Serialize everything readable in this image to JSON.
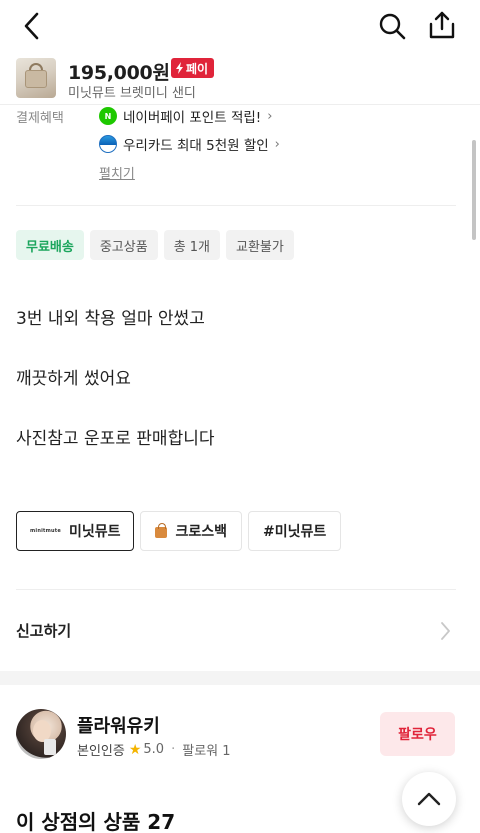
{
  "product": {
    "price": "195,000원",
    "pay_badge": "페이",
    "name": "미닛뮤트 브렛미니 샌디"
  },
  "benefits": {
    "label": "결제혜택",
    "items": [
      {
        "text": "네이버페이 포인트 적립!",
        "icon": "naver-pay-icon"
      },
      {
        "text": "우리카드 최대 5천원 할인",
        "icon": "woori-card-icon"
      }
    ],
    "unfold_label": "펼치기"
  },
  "tags": [
    {
      "label": "무료배송",
      "color": "#1aa55c"
    },
    {
      "label": "중고상품"
    },
    {
      "label": "총 1개"
    },
    {
      "label": "교환불가"
    }
  ],
  "description": [
    "3번 내외 착용 얼마 안썼고",
    "깨끗하게 썼어요",
    "사진참고 운포로 판매합니다"
  ],
  "chips": [
    {
      "label": "미닛뮤트",
      "logo_text": "minitmute"
    },
    {
      "label": "크로스백"
    },
    {
      "label": "#미닛뮤트"
    }
  ],
  "report_label": "신고하기",
  "seller": {
    "name": "플라워유키",
    "verified_label": "본인인증",
    "rating": "5.0",
    "followers": "팔로워 1",
    "follow_button": "팔로우"
  },
  "shop_section_title": "이 상점의 상품 27",
  "colors": {
    "accent_red": "#e0243a",
    "free_shipping_green": "#1aa55c"
  }
}
